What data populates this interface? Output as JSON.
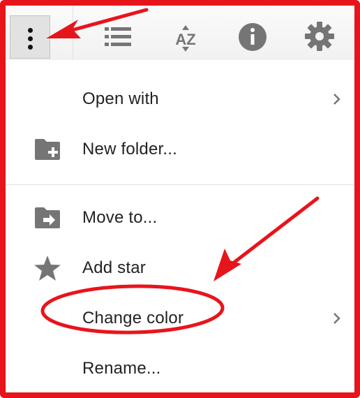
{
  "toolbar": {
    "buttons": [
      {
        "name": "more-options",
        "icon": "kebab-vertical-icon"
      },
      {
        "name": "list-view",
        "icon": "list-icon"
      },
      {
        "name": "sort",
        "icon": "sort-az-icon",
        "text": "AZ"
      },
      {
        "name": "details",
        "icon": "info-icon"
      },
      {
        "name": "settings",
        "icon": "gear-icon"
      }
    ]
  },
  "menu": {
    "items": [
      {
        "label": "Open with",
        "icon": "",
        "has_submenu": true
      },
      {
        "label": "New folder...",
        "icon": "folder-plus-icon",
        "has_submenu": false
      },
      {
        "label": "Move to...",
        "icon": "folder-move-icon",
        "has_submenu": false
      },
      {
        "label": "Add star",
        "icon": "star-icon",
        "has_submenu": false
      },
      {
        "label": "Change color",
        "icon": "",
        "has_submenu": true
      },
      {
        "label": "Rename...",
        "icon": "",
        "has_submenu": false
      }
    ]
  },
  "annotations": {
    "color": "#e8141b",
    "arrows": 2,
    "highlighted_item": "Change color"
  },
  "colors": {
    "icon_gray": "#757575",
    "text": "#222222",
    "toolbar_bg": "#f3f3f3",
    "accent_red": "#e8141b"
  }
}
